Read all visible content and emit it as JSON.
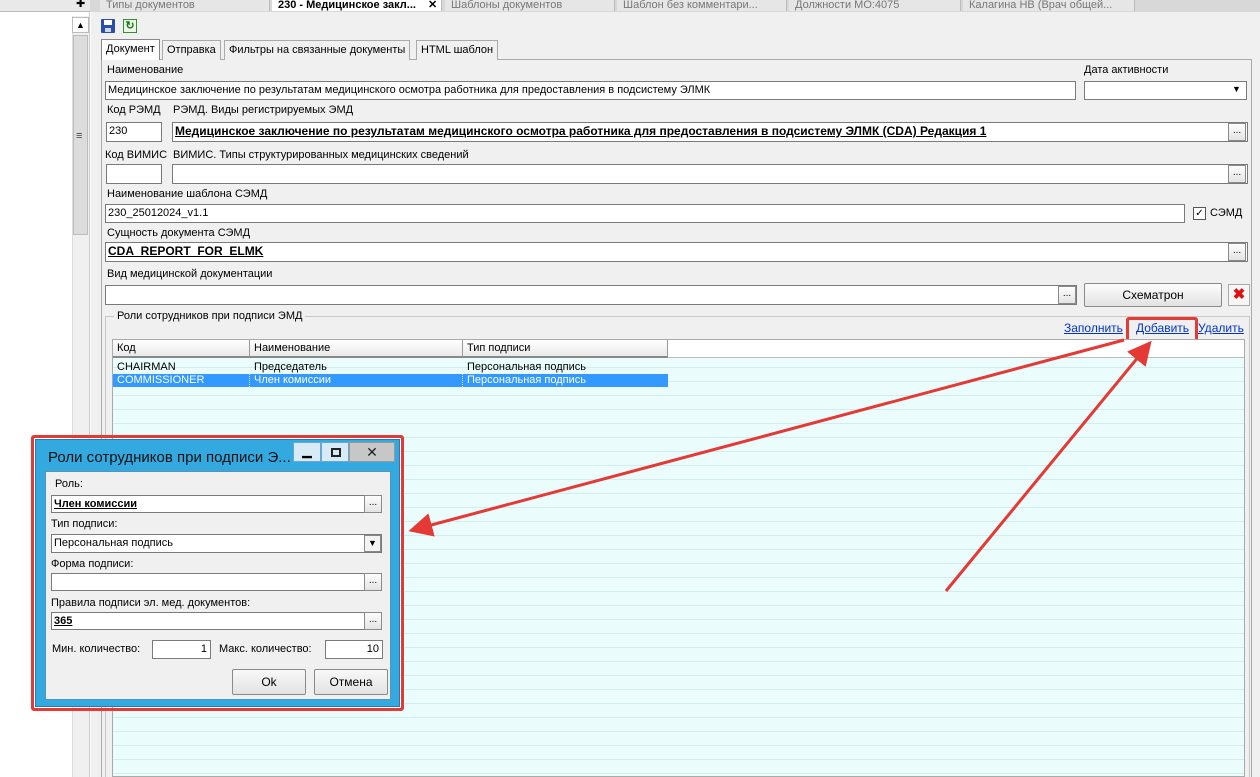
{
  "doc_tabs": [
    {
      "label": "Типы документов"
    },
    {
      "label": "230 - Медицинское закл..."
    },
    {
      "label": "Шаблоны документов"
    },
    {
      "label": "Шаблон без комментари..."
    },
    {
      "label": "Должности МО:4075"
    },
    {
      "label": "Калагина НВ (Врач общей..."
    }
  ],
  "toolbar": {
    "save_icon": "floppy-disk",
    "refresh_icon": "refresh"
  },
  "inner_tabs": [
    "Документ",
    "Отправка",
    "Фильтры на связанные документы",
    "HTML шаблон"
  ],
  "form": {
    "name_label": "Наименование",
    "name_value": "Медицинское заключение по результатам медицинского осмотра работника для предоставления в подсистему ЭЛМК",
    "date_label": "Дата активности",
    "rmd_code_label": "Код РЭМД",
    "rmd_code_value": "230",
    "rmd_types_label": "РЭМД. Виды регистрируемых ЭМД",
    "rmd_types_value": "Медицинское заключение по результатам медицинского осмотра работника для предоставления в подсистему ЭЛМК (CDA) Редакция 1",
    "vimis_code_label": "Код ВИМИС",
    "vimis_types_label": "ВИМИС. Типы структурированных медицинских сведений",
    "semd_template_label": "Наименование шаблона СЭМД",
    "semd_template_value": "230_25012024_v1.1",
    "semd_checkbox_label": "СЭМД",
    "semd_entity_label": "Сущность документа СЭМД",
    "semd_entity_value": "CDA_REPORT_FOR_ELMK",
    "med_doc_type_label": "Вид медицинской документации",
    "schematron_label": "Схематрон"
  },
  "roles": {
    "group_label": "Роли сотрудников при подписи ЭМД",
    "fill_link": "Заполнить",
    "add_link": "Добавить",
    "delete_link": "Удалить",
    "columns": [
      "Код",
      "Наименование",
      "Тип подписи"
    ],
    "rows": [
      {
        "code": "CHAIRMAN",
        "name": "Председатель",
        "sign_type": "Персональная подпись"
      },
      {
        "code": "COMMISSIONER",
        "name": "Член комиссии",
        "sign_type": "Персональная подпись"
      }
    ]
  },
  "dialog": {
    "title": "Роли сотрудников при подписи Э...",
    "role_label": "Роль:",
    "role_value": "Член комиссии",
    "sign_type_label": "Тип подписи:",
    "sign_type_value": "Персональная подпись",
    "sign_form_label": "Форма подписи:",
    "sign_rules_label": "Правила подписи эл. мед. документов:",
    "sign_rules_value": "365",
    "min_label": "Мин. количество:",
    "min_value": "1",
    "max_label": "Макс. количество:",
    "max_value": "10",
    "ok_label": "Ok",
    "cancel_label": "Отмена"
  },
  "colors": {
    "selected_row": "#3399ff",
    "grid_bg": "#eafcfc",
    "highlight": "#e53935",
    "dialog_frame": "#33a9e0",
    "window_title": "#1aa0db"
  }
}
